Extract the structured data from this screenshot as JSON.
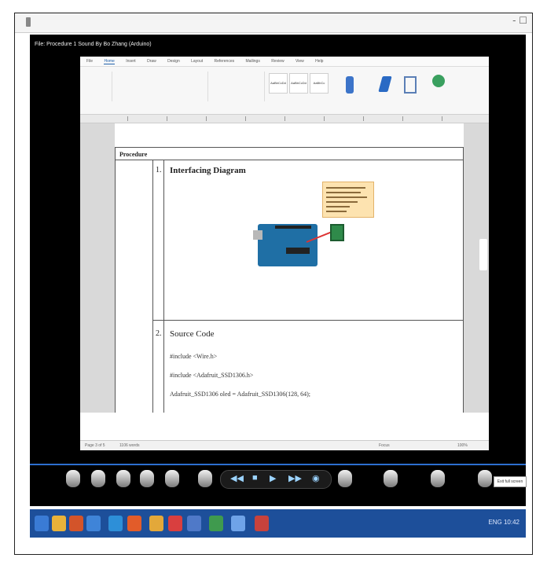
{
  "player": {
    "window_controls": "- ☐",
    "video_title": "File: Procedure 1 Sound By Bo Zhang (Arduino)"
  },
  "word": {
    "tabs": [
      "File",
      "Home",
      "Insert",
      "Draw",
      "Design",
      "Layout",
      "References",
      "Mailings",
      "Review",
      "View",
      "Help"
    ],
    "active_tab": "Home",
    "style_boxes": [
      "AaBbCcDd",
      "AaBbCcDd",
      "AaBbCc"
    ],
    "document": {
      "procedure_label": "Procedure",
      "step1_num": "1.",
      "step1_title": "Interfacing Diagram",
      "step2_num": "2.",
      "step2_title": "Source Code",
      "code_lines": [
        "#include <Wire.h>",
        "#include <Adafruit_SSD1306.h>",
        "Adafruit_SSD1306 oled = Adafruit_SSD1306(128, 64);"
      ]
    },
    "status": {
      "page": "Page 3 of 5",
      "words": "1106 words",
      "focus": "Focus",
      "zoom": "100%"
    }
  },
  "controls": {
    "tooltip": "Exit full screen"
  },
  "taskbar": {
    "tray_text": "ENG 10:42"
  }
}
